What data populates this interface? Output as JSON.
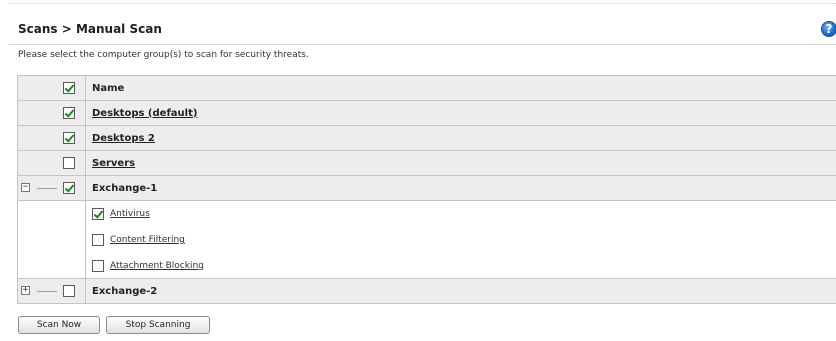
{
  "header": {
    "breadcrumb": "Scans > Manual Scan",
    "help_icon": "?"
  },
  "instructions": "Please select the computer group(s) to scan for security threats.",
  "table": {
    "header_label": "Name",
    "header_checked": true,
    "rows": [
      {
        "label": "Desktops (default)",
        "checked": true
      },
      {
        "label": "Desktops 2",
        "checked": true
      },
      {
        "label": "Servers",
        "checked": false
      }
    ],
    "exchange1": {
      "label": "Exchange-1",
      "checked": true,
      "expanded": true,
      "toggle_symbol": "−",
      "children": [
        {
          "label": "Antivirus",
          "checked": true
        },
        {
          "label": "Content Filtering",
          "checked": false
        },
        {
          "label": "Attachment Blocking",
          "checked": false
        }
      ]
    },
    "exchange2": {
      "label": "Exchange-2",
      "checked": false,
      "expanded": false,
      "toggle_symbol": "+"
    }
  },
  "buttons": {
    "scan_now": "Scan Now",
    "stop_scanning": "Stop Scanning"
  },
  "colors": {
    "row_gray": "#ededed",
    "check_green": "#1a8a1a",
    "help_blue": "#1461c4"
  }
}
